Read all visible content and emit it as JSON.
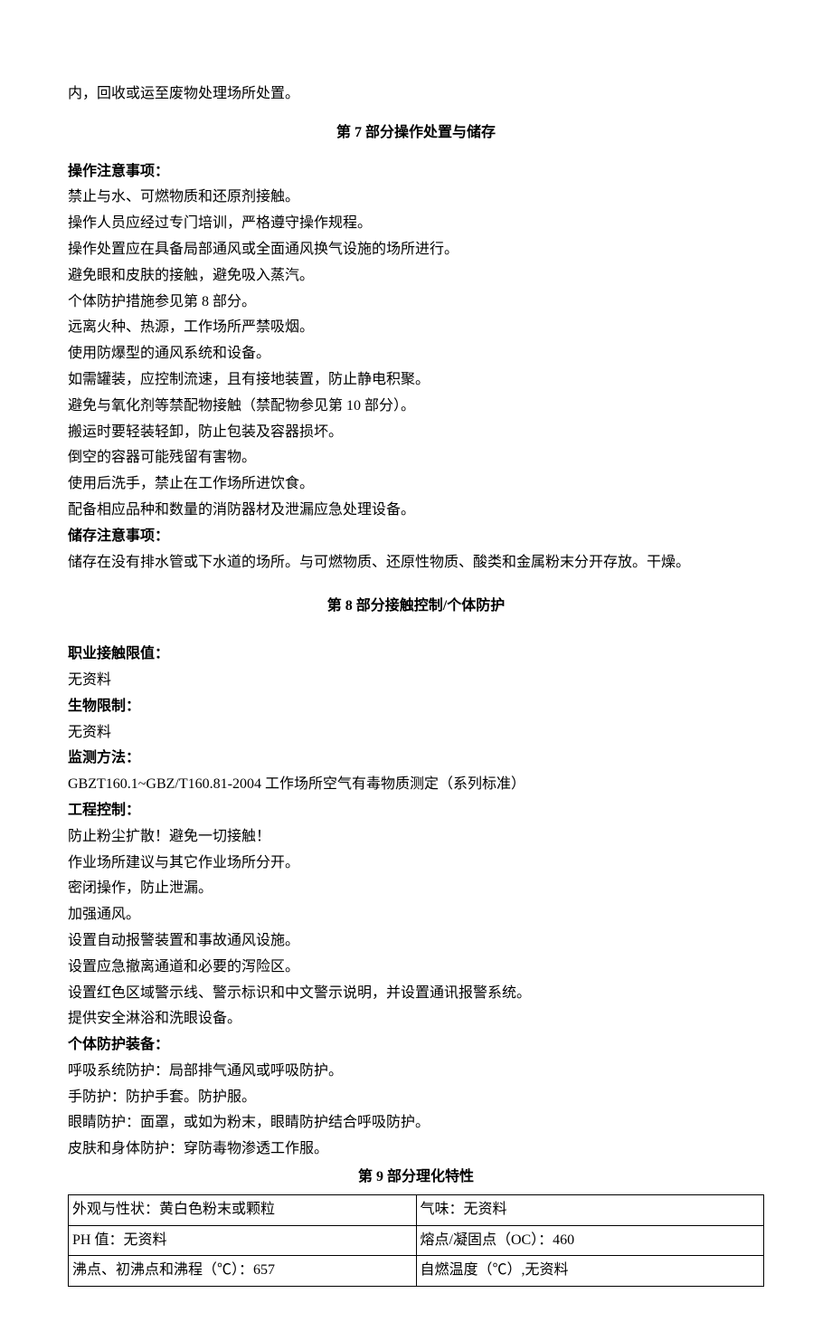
{
  "top_fragment": "内，回收或运至废物处理场所处置。",
  "section7": {
    "title": "第 7 部分操作处置与储存",
    "op_heading": "操作注意事项：",
    "op_lines": [
      "禁止与水、可燃物质和还原剂接触。",
      "操作人员应经过专门培训，严格遵守操作规程。",
      "操作处置应在具备局部通风或全面通风换气设施的场所进行。",
      "避免眼和皮肤的接触，避免吸入蒸汽。",
      "个体防护措施参见第 8 部分。",
      "远离火种、热源，工作场所严禁吸烟。",
      "使用防爆型的通风系统和设备。",
      "如需罐装，应控制流速，且有接地装置，防止静电积聚。",
      "避免与氧化剂等禁配物接触（禁配物参见第 10 部分）。",
      "搬运时要轻装轻卸，防止包装及容器损坏。",
      "倒空的容器可能残留有害物。",
      "使用后洗手，禁止在工作场所进饮食。",
      "配备相应品种和数量的消防器材及泄漏应急处理设备。"
    ],
    "store_heading": "储存注意事项：",
    "store_text": "储存在没有排水管或下水道的场所。与可燃物质、还原性物质、酸类和金属粉末分开存放。干燥。"
  },
  "section8": {
    "title": "第 8 部分接触控制/个体防护",
    "occ_heading": "职业接触限值：",
    "occ_text": "无资料",
    "bio_heading": "生物限制：",
    "bio_text": "无资料",
    "monitor_heading": "监测方法：",
    "monitor_text": "GBZT160.1~GBZ/T160.81-2004 工作场所空气有毒物质测定（系列标准）",
    "eng_heading": "工程控制：",
    "eng_lines": [
      "防止粉尘扩散！避免一切接触！",
      "作业场所建议与其它作业场所分开。",
      "密闭操作，防止泄漏。",
      "加强通风。",
      "设置自动报警装置和事故通风设施。",
      "设置应急撤离通道和必要的泻险区。",
      "设置红色区域警示线、警示标识和中文警示说明，并设置通讯报警系统。",
      "提供安全淋浴和洗眼设备。"
    ],
    "ppe_heading": "个体防护装备：",
    "ppe_lines": [
      "呼吸系统防护：局部排气通风或呼吸防护。",
      "手防护：防护手套。防护服。",
      "眼睛防护：面罩，或如为粉末，眼睛防护结合呼吸防护。",
      "皮肤和身体防护：穿防毒物渗透工作服。"
    ]
  },
  "section9": {
    "title": "第 9 部分理化特性",
    "rows": [
      {
        "left": "外观与性状：黄白色粉末或颗粒",
        "right": "气味：无资料"
      },
      {
        "left": "PH 值：无资料",
        "right": "熔点/凝固点（OC）：460"
      },
      {
        "left": "沸点、初沸点和沸程（℃）：657",
        "right": "自燃温度（℃）,无资料"
      }
    ]
  }
}
